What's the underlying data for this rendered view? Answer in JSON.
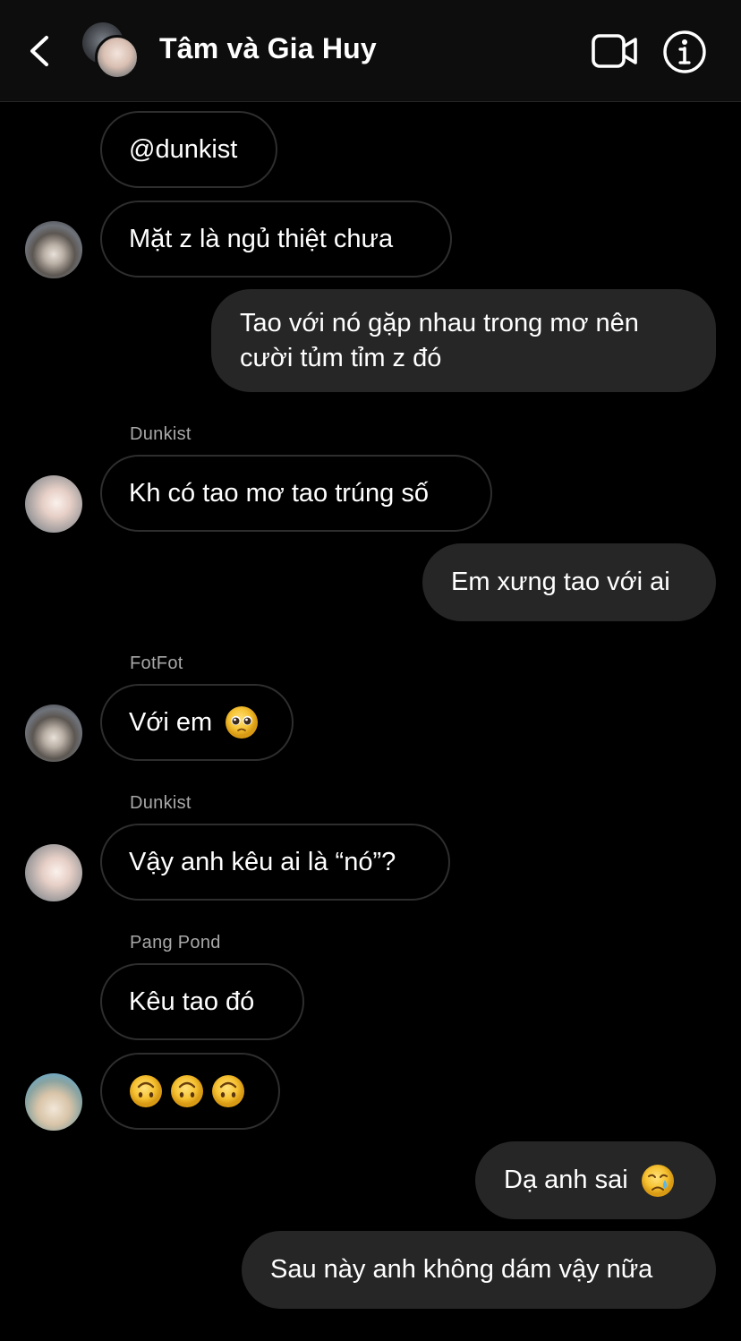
{
  "header": {
    "title": "Tâm và Gia Huy",
    "icons": {
      "back": "chevron-left-icon",
      "video": "video-call-icon",
      "info": "info-icon"
    }
  },
  "messages": [
    {
      "direction": "incoming",
      "text": "@dunkist"
    },
    {
      "direction": "incoming",
      "text": "Mặt z là ngủ thiệt chưa",
      "avatar": "cat"
    },
    {
      "direction": "outgoing",
      "text": "Tao với nó gặp nhau trong mơ nên cười tủm tỉm z đó"
    },
    {
      "direction": "incoming",
      "sender": "Dunkist",
      "text": "Kh có tao mơ tao trúng số",
      "avatar": "boy"
    },
    {
      "direction": "outgoing",
      "text": "Em xưng tao với ai"
    },
    {
      "direction": "incoming",
      "sender": "FotFot",
      "text": "Với em",
      "emoji": "pleading-face",
      "avatar": "cat"
    },
    {
      "direction": "incoming",
      "sender": "Dunkist",
      "text": "Vậy anh kêu ai là “nó”?",
      "avatar": "boy"
    },
    {
      "direction": "incoming",
      "sender": "Pang Pond",
      "text": "Kêu tao đó"
    },
    {
      "direction": "incoming",
      "emoji_count": 3,
      "emoji": "upside-down-face",
      "avatar": "dog"
    },
    {
      "direction": "outgoing",
      "text": "Dạ anh sai",
      "emoji": "crying-face"
    },
    {
      "direction": "outgoing",
      "text": "Sau này anh không dám vậy nữa"
    }
  ],
  "colors": {
    "background": "#000000",
    "header": "#0d0d0d",
    "incoming_border": "#2e2e2e",
    "outgoing_bubble": "#262626",
    "sender_name": "#a8a8a8"
  }
}
